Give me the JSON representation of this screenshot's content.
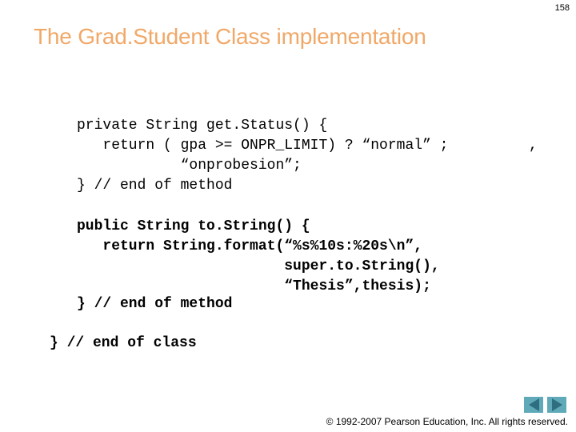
{
  "slide_number": "158",
  "title": "The Grad.Student Class implementation",
  "code_blocks": [
    {
      "lines": [
        "private String get.Status() {",
        "   return ( gpa >= ONPR_LIMIT) ? “normal” ;",
        "            “onprobesion”;",
        "} // end of method"
      ],
      "stray": ","
    },
    {
      "lines": [
        "public String to.String() {",
        "   return String.format(“%s%10s:%20s\\n”,",
        "                        super.to.String(),",
        "                        “Thesis”,thesis);",
        "} // end of method"
      ]
    },
    {
      "lines": [
        "} // end of class"
      ]
    }
  ],
  "navigation": {
    "prev_icon": "triangle-left",
    "next_icon": "triangle-right",
    "button_color": "#5fa9b9",
    "arrow_color": "#2e6e7e"
  },
  "footer": {
    "copyright": "© 1992-2007 Pearson Education, Inc.  All rights reserved."
  },
  "colors": {
    "title": "#f0a868"
  }
}
